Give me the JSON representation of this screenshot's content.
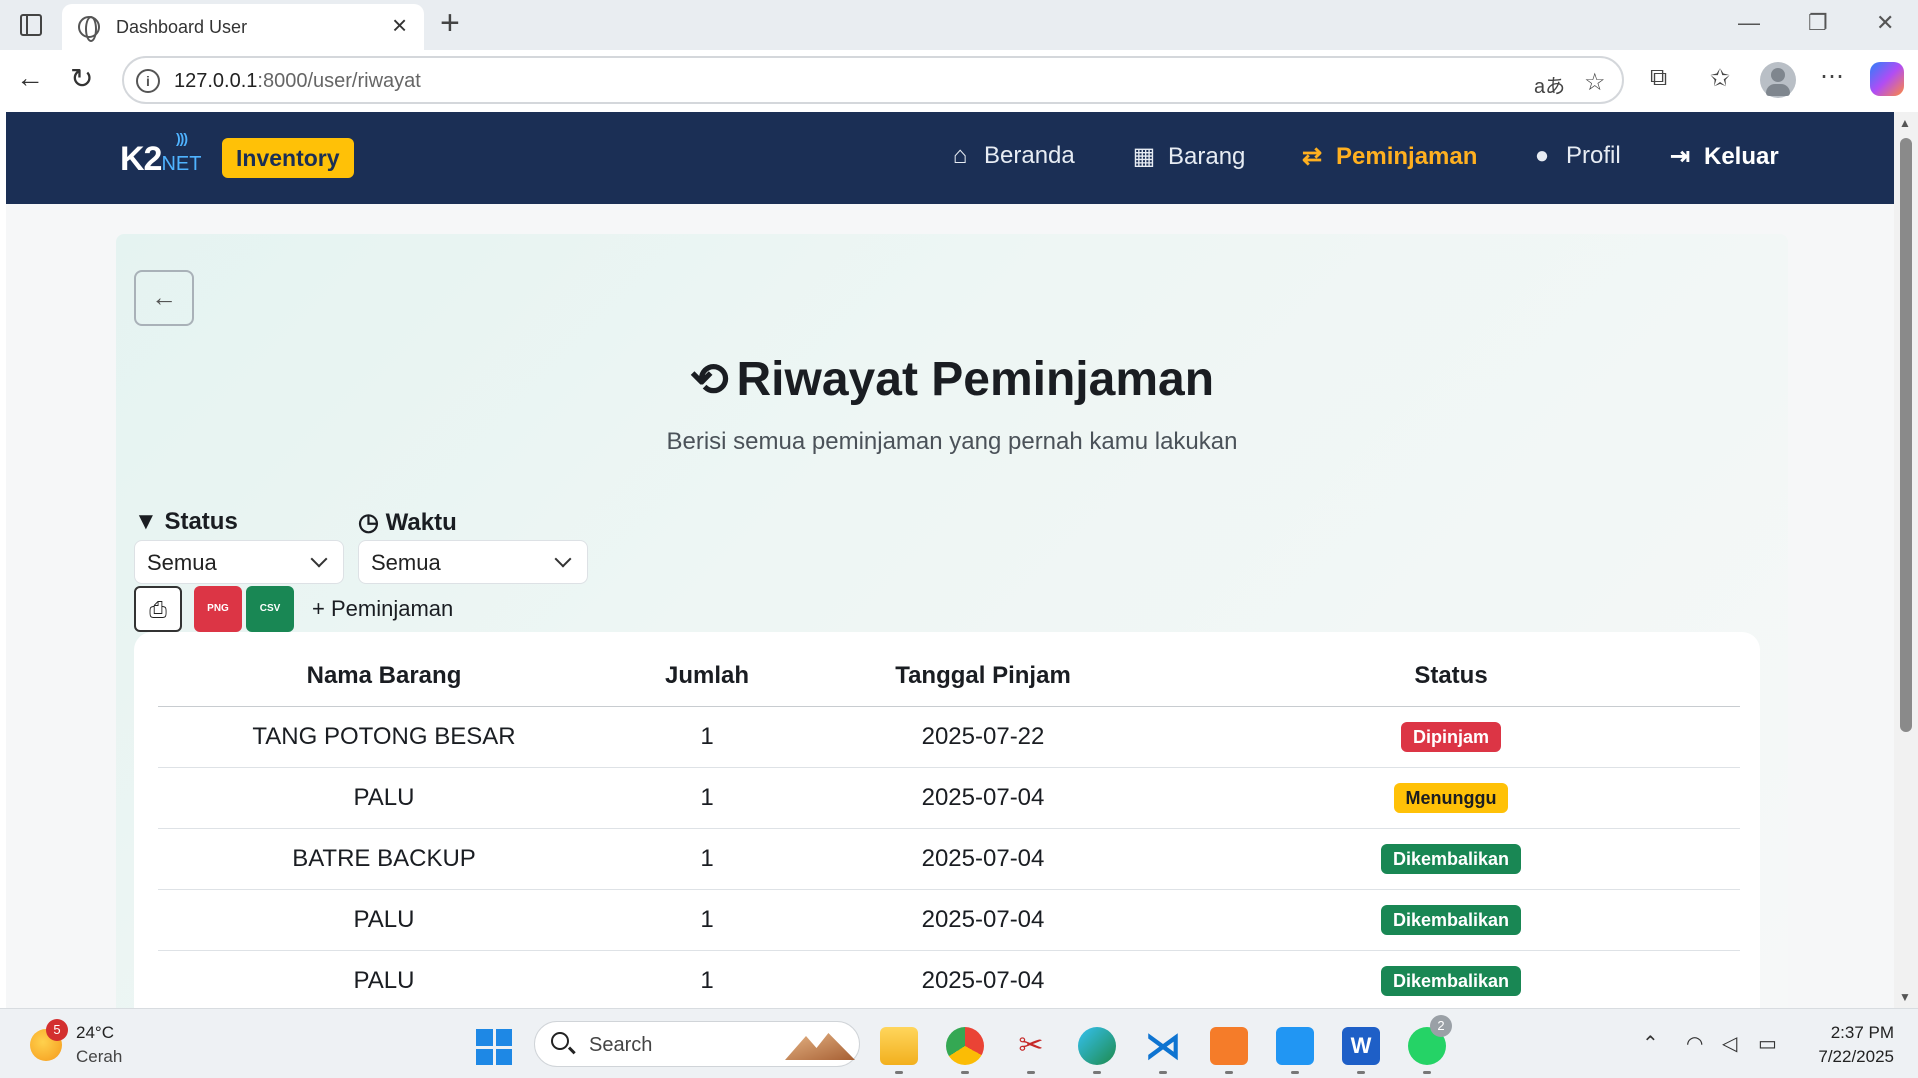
{
  "browser": {
    "tab_title": "Dashboard User",
    "url_host": "127.0.0.1",
    "url_path": ":8000/user/riwayat"
  },
  "navbar": {
    "logo_main": "K2",
    "logo_sub": "NET",
    "brand_badge": "Inventory",
    "items": [
      {
        "label": "Beranda",
        "icon": "home-icon"
      },
      {
        "label": "Barang",
        "icon": "boxes-icon"
      },
      {
        "label": "Peminjaman",
        "icon": "exchange-icon",
        "active": true
      },
      {
        "label": "Profil",
        "icon": "user-icon"
      },
      {
        "label": "Keluar",
        "icon": "logout-icon"
      }
    ],
    "colors": {
      "bg": "#1b2f55",
      "active": "#ffb020",
      "badge": "#ffc107"
    }
  },
  "page": {
    "title": "Riwayat Peminjaman",
    "subtitle": "Berisi semua peminjaman yang pernah kamu lakukan"
  },
  "filters": {
    "status_label": "Status",
    "status_value": "Semua",
    "waktu_label": "Waktu",
    "waktu_value": "Semua"
  },
  "actions": {
    "png_label": "PNG",
    "csv_label": "CSV",
    "add_label": "Peminjaman"
  },
  "table": {
    "headers": [
      "Nama Barang",
      "Jumlah",
      "Tanggal Pinjam",
      "Status"
    ],
    "rows": [
      {
        "nama": "TANG POTONG BESAR",
        "jumlah": "1",
        "tanggal": "2025-07-22",
        "status": "Dipinjam"
      },
      {
        "nama": "PALU",
        "jumlah": "1",
        "tanggal": "2025-07-04",
        "status": "Menunggu"
      },
      {
        "nama": "BATRE BACKUP",
        "jumlah": "1",
        "tanggal": "2025-07-04",
        "status": "Dikembalikan"
      },
      {
        "nama": "PALU",
        "jumlah": "1",
        "tanggal": "2025-07-04",
        "status": "Dikembalikan"
      },
      {
        "nama": "PALU",
        "jumlah": "1",
        "tanggal": "2025-07-04",
        "status": "Dikembalikan"
      }
    ],
    "status_colors": {
      "Dipinjam": {
        "bg": "#dc3545",
        "fg": "#ffffff"
      },
      "Menunggu": {
        "bg": "#ffc107",
        "fg": "#1a1d22"
      },
      "Dikembalikan": {
        "bg": "#198754",
        "fg": "#ffffff"
      }
    }
  },
  "taskbar": {
    "weather_temp": "24°C",
    "weather_desc": "Cerah",
    "weather_notif": "5",
    "search_label": "Search",
    "whatsapp_badge": "2",
    "time": "2:37 PM",
    "date": "7/22/2025"
  }
}
